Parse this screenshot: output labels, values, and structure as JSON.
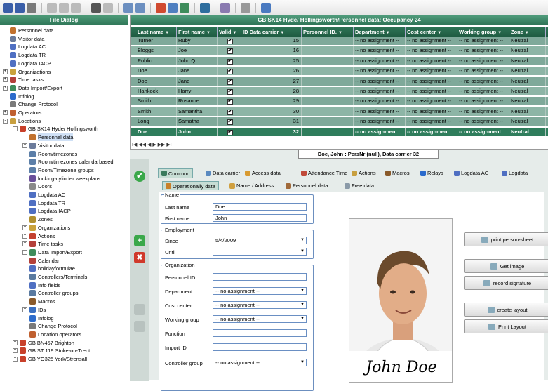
{
  "left_panel": {
    "title": "File Dialog",
    "items": [
      {
        "label": "Personnel data",
        "indent": 0,
        "icon": "person-icon",
        "color": "#c2722e"
      },
      {
        "label": "Visitor data",
        "indent": 0,
        "icon": "visitor-icon",
        "color": "#6b7b9b"
      },
      {
        "label": "Logdata AC",
        "indent": 0,
        "icon": "log-icon",
        "color": "#4f6fc2"
      },
      {
        "label": "Logdata TR",
        "indent": 0,
        "icon": "log-icon",
        "color": "#4f6fc2"
      },
      {
        "label": "Logdata IACP",
        "indent": 0,
        "icon": "log-icon",
        "color": "#4f6fc2"
      },
      {
        "label": "Organizations",
        "indent": 0,
        "icon": "organization-icon",
        "color": "#c9a23c",
        "exp": "+"
      },
      {
        "label": "Time tasks",
        "indent": 0,
        "icon": "calendar-icon",
        "color": "#b3403a",
        "exp": "+"
      },
      {
        "label": "Data Import/Export",
        "indent": 0,
        "icon": "import-export-icon",
        "color": "#3e8c5b",
        "exp": "+"
      },
      {
        "label": "Infolog",
        "indent": 0,
        "icon": "info-icon",
        "color": "#2d6ccc"
      },
      {
        "label": "Change Protocol",
        "indent": 0,
        "icon": "protocol-icon",
        "color": "#7a7a7a"
      },
      {
        "label": "Operators",
        "indent": 0,
        "icon": "operators-icon",
        "color": "#c06030",
        "exp": "+"
      },
      {
        "label": "Locations",
        "indent": 0,
        "icon": "locations-icon",
        "color": "#c8a040",
        "exp": "-"
      },
      {
        "label": "GB SK14 Hyde/ Hollingsworth",
        "indent": 1,
        "icon": "location-pin-icon",
        "color": "#c8402a",
        "exp": "-"
      },
      {
        "label": "Personnel data",
        "indent": 2,
        "icon": "person-icon",
        "color": "#c2722e"
      },
      {
        "label": "Visitor data",
        "indent": 2,
        "icon": "visitor-icon",
        "color": "#6b7b9b",
        "exp": "+"
      },
      {
        "label": "Room/timezones",
        "indent": 2,
        "icon": "clock-icon",
        "color": "#5c7fa8"
      },
      {
        "label": "Room/timezones calendarbased",
        "indent": 2,
        "icon": "clock-icon",
        "color": "#5c7fa8"
      },
      {
        "label": "Room/Timezone groups",
        "indent": 2,
        "icon": "clock-icon",
        "color": "#5c7fa8"
      },
      {
        "label": "locking-cylinder weekplans",
        "indent": 2,
        "icon": "key-icon",
        "color": "#6a4f9a"
      },
      {
        "label": "Doors",
        "indent": 2,
        "icon": "door-icon",
        "color": "#8a8a8a"
      },
      {
        "label": "Logdata AC",
        "indent": 2,
        "icon": "log-icon",
        "color": "#4f6fc2"
      },
      {
        "label": "Logdata TR",
        "indent": 2,
        "icon": "log-icon",
        "color": "#4f6fc2"
      },
      {
        "label": "Logdata IACP",
        "indent": 2,
        "icon": "log-icon",
        "color": "#4f6fc2"
      },
      {
        "label": "Zones",
        "indent": 2,
        "icon": "zones-icon",
        "color": "#b09030"
      },
      {
        "label": "Organizations",
        "indent": 2,
        "icon": "organization-icon",
        "color": "#c9a23c",
        "exp": "+"
      },
      {
        "label": "Actions",
        "indent": 2,
        "icon": "actions-icon",
        "color": "#c3402f",
        "exp": "+"
      },
      {
        "label": "Time tasks",
        "indent": 2,
        "icon": "calendar-icon",
        "color": "#b3403a",
        "exp": "+"
      },
      {
        "label": "Data Import/Export",
        "indent": 2,
        "icon": "import-export-icon",
        "color": "#3e8c5b",
        "exp": "+"
      },
      {
        "label": "Calendar",
        "indent": 2,
        "icon": "calendar-icon",
        "color": "#b3403a"
      },
      {
        "label": "holidayformulae",
        "indent": 2,
        "icon": "formula-icon",
        "color": "#4f6fc2"
      },
      {
        "label": "Controllers/Terminals",
        "indent": 2,
        "icon": "controller-icon",
        "color": "#5a7aa0"
      },
      {
        "label": "Info fields",
        "indent": 2,
        "icon": "info-fields-icon",
        "color": "#4f6fc2"
      },
      {
        "label": "Controller groups",
        "indent": 2,
        "icon": "controller-icon",
        "color": "#5a7aa0"
      },
      {
        "label": "Macros",
        "indent": 2,
        "icon": "macros-icon",
        "color": "#8a5a2a"
      },
      {
        "label": "IDs",
        "indent": 2,
        "icon": "id-icon",
        "color": "#3a6fc0",
        "exp": "+"
      },
      {
        "label": "Infolog",
        "indent": 2,
        "icon": "info-icon",
        "color": "#2d6ccc"
      },
      {
        "label": "Change Protocol",
        "indent": 2,
        "icon": "protocol-icon",
        "color": "#7a7a7a"
      },
      {
        "label": "Location operators",
        "indent": 2,
        "icon": "operators-icon",
        "color": "#c06030"
      },
      {
        "label": "GB BN457 Brighton",
        "indent": 1,
        "icon": "location-pin-icon",
        "color": "#c8402a",
        "exp": "+"
      },
      {
        "label": "GB ST 119 Stoke-on-Trent",
        "indent": 1,
        "icon": "location-pin-icon",
        "color": "#c8402a",
        "exp": "+"
      },
      {
        "label": "GB YO325 York/Strensall",
        "indent": 1,
        "icon": "location-pin-icon",
        "color": "#c8402a",
        "exp": "+"
      }
    ]
  },
  "grid": {
    "title": "GB SK14 Hyde/ Hollingsworth/Personnel data: Occupancy 24",
    "columns": [
      "Last name",
      "First name",
      "Valid",
      "ID Data carrier",
      "Personnel ID.",
      "Department",
      "Cost center",
      "Working group",
      "Zone"
    ],
    "rows": [
      {
        "last": "Turner",
        "first": "Ruby",
        "valid": "✔",
        "id": "15",
        "pid": "",
        "dept": "-- no assignment --",
        "cost": "-- no assignment --",
        "wg": "-- no assignment --",
        "zone": "Neutral"
      },
      {
        "last": "Bloggs",
        "first": "Joe",
        "valid": "✔",
        "id": "16",
        "pid": "",
        "dept": "-- no assignment --",
        "cost": "-- no assignment --",
        "wg": "-- no assignment --",
        "zone": "Neutral"
      },
      {
        "last": "Public",
        "first": "John Q",
        "valid": "✔",
        "id": "25",
        "pid": "",
        "dept": "-- no assignment --",
        "cost": "-- no assignment --",
        "wg": "-- no assignment --",
        "zone": "Neutral"
      },
      {
        "last": "Doe",
        "first": "Jane",
        "valid": "✔",
        "id": "26",
        "pid": "",
        "dept": "-- no assignment --",
        "cost": "-- no assignment --",
        "wg": "-- no assignment --",
        "zone": "Neutral"
      },
      {
        "last": "Doe",
        "first": "Jane",
        "valid": "✔",
        "id": "27",
        "pid": "",
        "dept": "-- no assignment --",
        "cost": "-- no assignment --",
        "wg": "-- no assignment --",
        "zone": "Neutral"
      },
      {
        "last": "Hankock",
        "first": "Harry",
        "valid": "✔",
        "id": "28",
        "pid": "",
        "dept": "-- no assignment --",
        "cost": "-- no assignment --",
        "wg": "-- no assignment --",
        "zone": "Neutral"
      },
      {
        "last": "Smith",
        "first": "Rosanne",
        "valid": "✔",
        "id": "29",
        "pid": "",
        "dept": "-- no assignment --",
        "cost": "-- no assignment --",
        "wg": "-- no assignment --",
        "zone": "Neutral"
      },
      {
        "last": "Smith",
        "first": "Samantha",
        "valid": "✔",
        "id": "30",
        "pid": "",
        "dept": "-- no assignment --",
        "cost": "-- no assignment --",
        "wg": "-- no assignment --",
        "zone": "Neutral"
      },
      {
        "last": "Long",
        "first": "Samatha",
        "valid": "✔",
        "id": "31",
        "pid": "",
        "dept": "-- no assignment --",
        "cost": "-- no assignment --",
        "wg": "-- no assignment --",
        "zone": "Neutral"
      },
      {
        "last": "Doe",
        "first": "John",
        "valid": "✔",
        "id": "32",
        "pid": "",
        "dept": "-- no assignmen",
        "cost": "-- no assignmen",
        "wg": "-- no assignment",
        "zone": "Neutral",
        "selected": true
      }
    ],
    "nav_label": "I◀ ◀◀ ◀ ▶ ▶▶ ▶I"
  },
  "detail": {
    "title": "Doe, John : PersNr (null), Data carrier 32",
    "tabs_top": [
      "Common",
      "Data carrier",
      "Access data",
      "Attendance Time",
      "Actions",
      "Macros",
      "Relays",
      "Logdata AC",
      "Logdata"
    ],
    "tabs_sub": [
      "Operationally data",
      "Name / Address",
      "Personnel data",
      "Free data"
    ],
    "name_group": {
      "legend": "Name",
      "last_label": "Last name",
      "last_value": "Doe",
      "first_label": "First name",
      "first_value": "John"
    },
    "employment_group": {
      "legend": "Employment",
      "since_label": "Since",
      "since_value": "5/4/2009",
      "until_label": "Until",
      "until_value": ""
    },
    "organization_group": {
      "legend": "Organization",
      "personnel_id_label": "Personnel ID",
      "personnel_id_value": "",
      "department_label": "Department",
      "department_value": "-- no assignment --",
      "cost_center_label": "Cost center",
      "cost_center_value": "-- no assignment --",
      "working_group_label": "Working group",
      "working_group_value": "-- no assignment --",
      "function_label": "Function",
      "function_value": "",
      "import_id_label": "Import ID",
      "import_id_value": "",
      "controller_group_label": "Controller group",
      "controller_group_value": "-- no assignment --"
    },
    "signature": "John Doe",
    "buttons": {
      "print_sheet": "print person-sheet",
      "get_image": "Get image",
      "record_signature": "record signature",
      "create_layout": "create layout",
      "print_layout": "Print Layout"
    }
  },
  "colors": {
    "header_green": "#2d7355",
    "row_green": "#7fa99a",
    "selected_row": "#2f7d5c"
  }
}
